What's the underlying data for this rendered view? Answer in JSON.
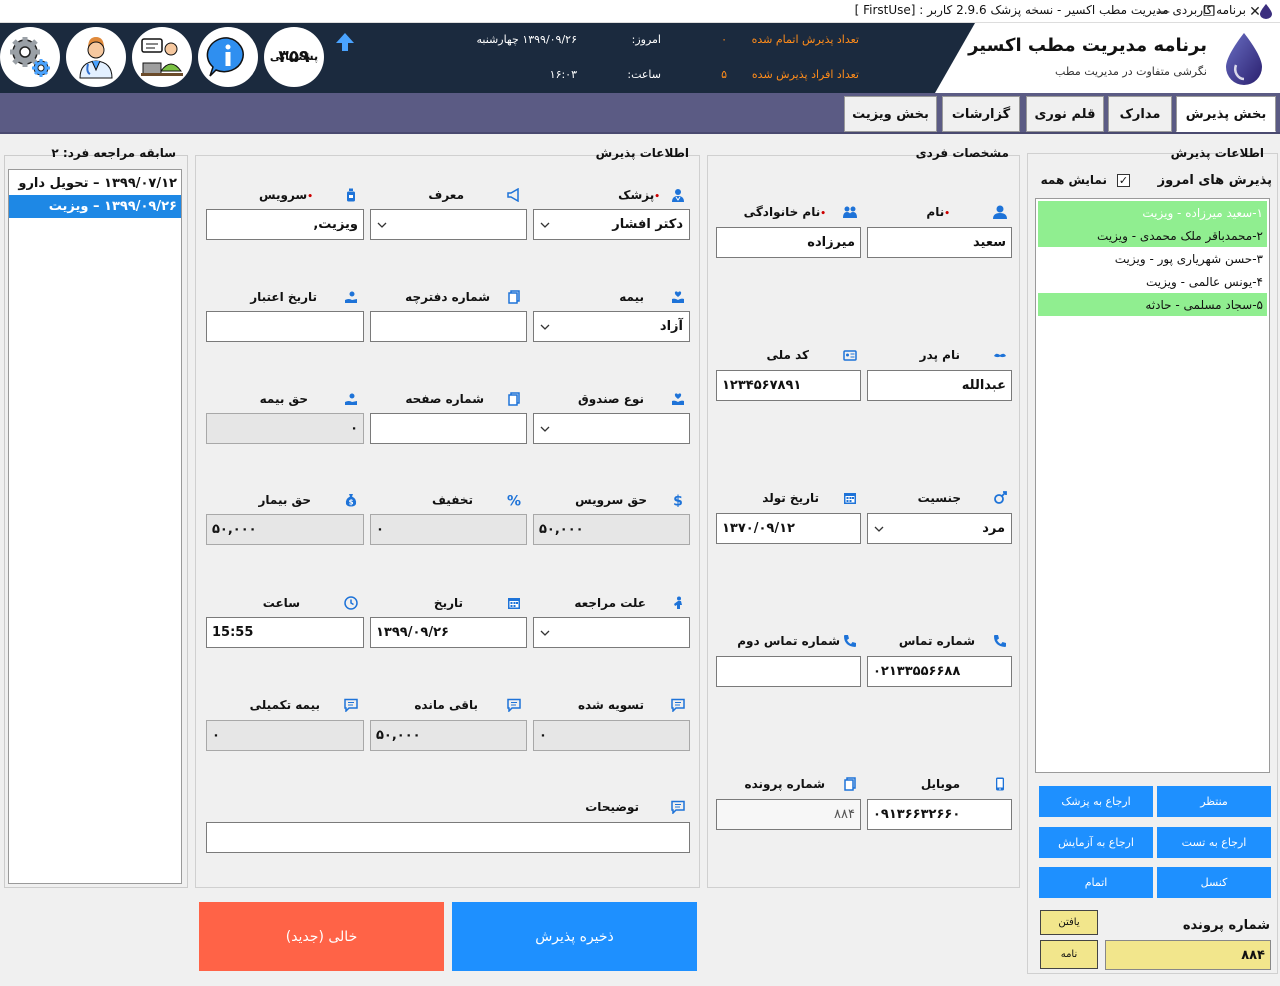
{
  "window": {
    "title": "برنامه کاربردی مدیریت مطب اکسیر - نسخه پزشک 2.9.6 کاربر : [FirstUse ]",
    "minimize": "—",
    "maximize": "❐",
    "close": "✕"
  },
  "header": {
    "brand_title": "برنامه مدیریت مطب اکسیر",
    "brand_subtitle": "نگرشی متفاوت در مدیریت مطب",
    "finished_label": "تعداد پذیرش اتمام شده",
    "finished_value": "۰",
    "admitted_label": "تعداد افراد پذیرش شده",
    "admitted_value": "۵",
    "today_label": "امروز:",
    "today_value": "۱۳۹۹/۰۹/۲۶ چهارشنبه",
    "time_label": "ساعت:",
    "time_value": "۱۶:۰۳",
    "support_number": "۳۵۹",
    "support_label": "پشتیبانی"
  },
  "tabs": [
    {
      "label": "بخش پذیرش"
    },
    {
      "label": "مدارک"
    },
    {
      "label": "قلم نوری"
    },
    {
      "label": "گزارشات"
    },
    {
      "label": "بخش ویزیت"
    }
  ],
  "reception_panel": {
    "title": "اطلاعات پذیرش",
    "today_label": "پذیرش های امروز",
    "show_all_label": "نمایش همه",
    "show_all_checked": true,
    "items": [
      {
        "text": "۱-سعید میرزاده - ویزیت",
        "highlight": true
      },
      {
        "text": "۲-محمدباقر ملک محمدی - ویزیت",
        "highlight": true
      },
      {
        "text": "۳-حسن شهریاری پور - ویزیت",
        "highlight": false
      },
      {
        "text": "۴-یونس عالمی - ویزیت",
        "highlight": false
      },
      {
        "text": "۵-سجاد مسلمی - حادثه",
        "highlight": true
      }
    ],
    "buttons": {
      "waiting": "منتظر",
      "refer_doctor": "ارجاع به پزشک",
      "refer_test": "ارجاع به تست",
      "refer_lab": "ارجاع به آزمایش",
      "cancel": "کنسل",
      "finish": "اتمام"
    },
    "file_number_label": "شماره پرونده",
    "file_number_value": "۸۸۴",
    "find_button": "یافتن",
    "letter_button": "نامه"
  },
  "personal": {
    "title": "مشخصات فردی",
    "first_name_label": "نام",
    "first_name": "سعید",
    "last_name_label": "نام خانوادگی",
    "last_name": "میرزاده",
    "father_label": "نام پدر",
    "father": "عبدالله",
    "national_id_label": "کد ملی",
    "national_id": "۱۲۳۴۵۶۷۸۹۱",
    "gender_label": "جنسیت",
    "gender": "مرد",
    "birth_label": "تاریخ تولد",
    "birth": "۱۳۷۰/۰۹/۱۲",
    "phone_label": "شماره تماس",
    "phone": "۰۲۱۳۳۵۵۶۶۸۸",
    "phone2_label": "شماره تماس دوم",
    "phone2": "",
    "mobile_label": "موبایل",
    "mobile": "۰۹۱۳۶۶۳۲۶۶۰",
    "file_no_label": "شماره پرونده",
    "file_no": "۸۸۴"
  },
  "admission": {
    "title": "اطلاعات پذیرش",
    "doctor_label": "پزشک",
    "doctor": "دکتر افشار",
    "referrer_label": "معرف",
    "referrer": "",
    "service_label": "سرویس",
    "service": "ویزیت,",
    "insurance_label": "بیمه",
    "insurance": "آزاد",
    "booklet_label": "شماره دفترچه",
    "booklet": "",
    "validity_label": "تاریخ اعتبار",
    "validity": "",
    "fund_label": "نوع صندوق",
    "fund": "",
    "page_label": "شماره صفحه",
    "page": "",
    "ins_share_label": "حق بیمه",
    "ins_share": "۰",
    "service_fee_label": "حق سرویس",
    "service_fee": "۵۰,۰۰۰",
    "discount_label": "تخفیف",
    "discount": "۰",
    "patient_share_label": "حق بیمار",
    "patient_share": "۵۰,۰۰۰",
    "reason_label": "علت مراجعه",
    "reason": "",
    "date_label": "تاریخ",
    "date": "۱۳۹۹/۰۹/۲۶",
    "time_label": "ساعت",
    "time": "15:55",
    "settled_label": "تسویه شده",
    "settled": "۰",
    "remaining_label": "باقی مانده",
    "remaining": "۵۰,۰۰۰",
    "supp_ins_label": "بیمه تکمیلی",
    "supp_ins": "۰",
    "notes_label": "توضیحات",
    "notes": ""
  },
  "history": {
    "title": "سابقه مراجعه فرد: ۲",
    "items": [
      {
        "text": "۱۳۹۹/۰۷/۱۲ – تحویل دارو",
        "selected": false
      },
      {
        "text": "۱۳۹۹/۰۹/۲۶ – ویزیت",
        "selected": true
      }
    ]
  },
  "actions": {
    "save": "ذخیره پذیرش",
    "clear": "خالی (جدید)"
  },
  "colors": {
    "header_bg": "#1b2a3e",
    "tabbar_bg": "#5b5b84",
    "accent_blue": "#1e90ff",
    "clear_red": "#ff6347",
    "highlight_green": "#90ee90",
    "stat_orange": "#ff8c1a"
  }
}
